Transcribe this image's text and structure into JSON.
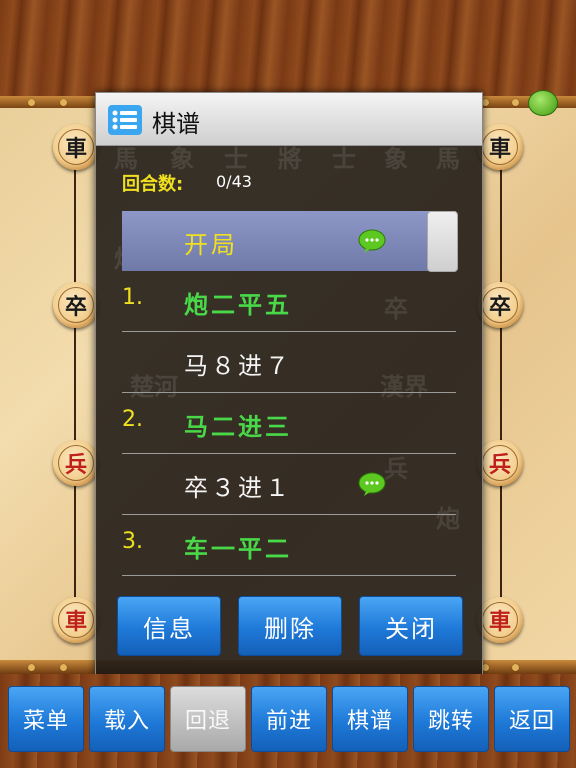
{
  "dialog": {
    "title": "棋谱",
    "rounds_label": "回合数:",
    "rounds_value": "0/43",
    "moves": [
      {
        "num": "",
        "text": "开局",
        "color": "yellow",
        "selected": true,
        "comment": true
      },
      {
        "num": "1.",
        "text": "炮二平五",
        "color": "green",
        "selected": false,
        "comment": false
      },
      {
        "num": "",
        "text": "马８进７",
        "color": "white",
        "selected": false,
        "comment": false
      },
      {
        "num": "2.",
        "text": "马二进三",
        "color": "green",
        "selected": false,
        "comment": false
      },
      {
        "num": "",
        "text": "卒３进１",
        "color": "white",
        "selected": false,
        "comment": true
      },
      {
        "num": "3.",
        "text": "车一平二",
        "color": "green",
        "selected": false,
        "comment": false
      }
    ],
    "buttons": {
      "info": "信息",
      "delete": "删除",
      "close": "关闭"
    }
  },
  "board": {
    "pieces_left": [
      "車",
      "卒",
      "兵",
      "車"
    ],
    "pieces_right": [
      "車",
      "卒",
      "兵",
      "車"
    ],
    "background_glyphs": [
      "馬",
      "象",
      "士",
      "將",
      "士",
      "象",
      "馬",
      "炮",
      "卒",
      "楚河",
      "漢界",
      "兵",
      "炮",
      "卒",
      "兵"
    ]
  },
  "toolbar": {
    "items": [
      {
        "label": "菜单",
        "enabled": true
      },
      {
        "label": "载入",
        "enabled": true
      },
      {
        "label": "回退",
        "enabled": false
      },
      {
        "label": "前进",
        "enabled": true
      },
      {
        "label": "棋谱",
        "enabled": true
      },
      {
        "label": "跳转",
        "enabled": true
      },
      {
        "label": "返回",
        "enabled": true
      }
    ]
  },
  "colors": {
    "accent_blue": "#1e79d8",
    "yellow": "#f0e020",
    "green": "#48d848"
  }
}
